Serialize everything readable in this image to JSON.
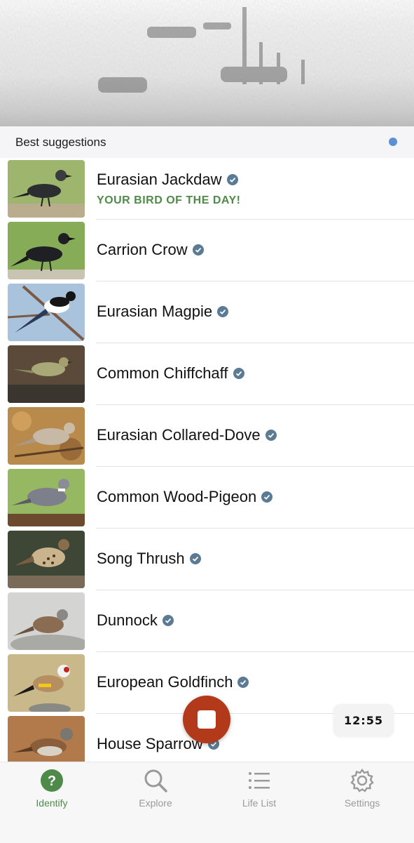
{
  "list_header": {
    "title": "Best suggestions"
  },
  "colors": {
    "accent_green": "#4f8b48",
    "record_red": "#b23a1b",
    "verified_blue": "#5b7a94",
    "live_dot_blue": "#5b8fd6"
  },
  "suggestions": [
    {
      "name": "Eurasian Jackdaw",
      "subtitle": "YOUR BIRD OF THE DAY!",
      "verified": true
    },
    {
      "name": "Carrion Crow",
      "verified": true
    },
    {
      "name": "Eurasian Magpie",
      "verified": true
    },
    {
      "name": "Common Chiffchaff",
      "verified": true
    },
    {
      "name": "Eurasian Collared-Dove",
      "verified": true
    },
    {
      "name": "Common Wood-Pigeon",
      "verified": true
    },
    {
      "name": "Song Thrush",
      "verified": true
    },
    {
      "name": "Dunnock",
      "verified": true
    },
    {
      "name": "European Goldfinch",
      "verified": true
    },
    {
      "name": "House Sparrow",
      "verified": true
    }
  ],
  "recording": {
    "timer": "12:55",
    "stop_icon": "stop-square-icon"
  },
  "tabs": [
    {
      "label": "Identify",
      "icon": "question-circle-icon",
      "active": true
    },
    {
      "label": "Explore",
      "icon": "search-icon",
      "active": false
    },
    {
      "label": "Life List",
      "icon": "list-icon",
      "active": false
    },
    {
      "label": "Settings",
      "icon": "gear-icon",
      "active": false
    }
  ]
}
